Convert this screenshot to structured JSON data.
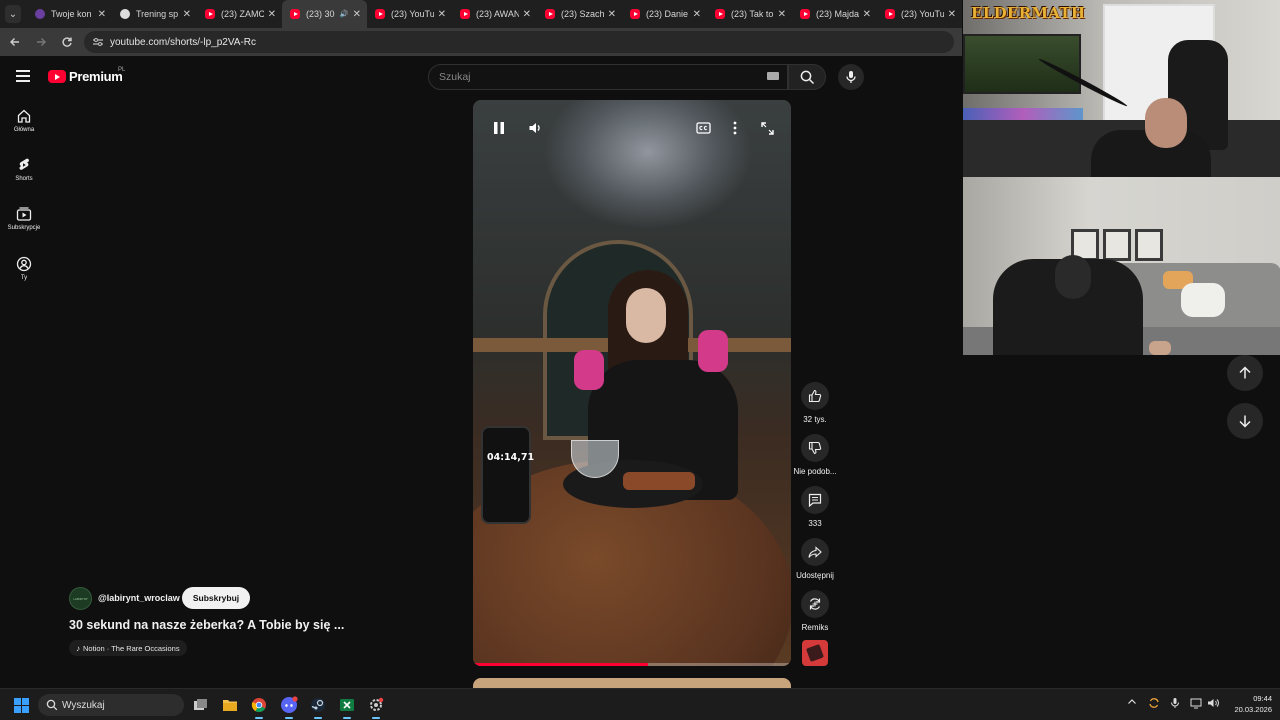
{
  "browser": {
    "tabs": [
      {
        "title": "Twoje kon",
        "favicon": "other-icon",
        "active": false
      },
      {
        "title": "Trening sp",
        "favicon": "soccer-ball-icon",
        "active": false
      },
      {
        "title": "(23) ZAMC",
        "favicon": "youtube-icon",
        "active": false
      },
      {
        "title": "(23) 30",
        "favicon": "youtube-icon",
        "active": true,
        "audio": true
      },
      {
        "title": "(23) YouTu",
        "favicon": "youtube-icon",
        "active": false
      },
      {
        "title": "(23) AWAN",
        "favicon": "youtube-icon",
        "active": false
      },
      {
        "title": "(23) Szach",
        "favicon": "youtube-icon",
        "active": false
      },
      {
        "title": "(23) Danie",
        "favicon": "youtube-icon",
        "active": false
      },
      {
        "title": "(23) Tak to",
        "favicon": "youtube-icon",
        "active": false
      },
      {
        "title": "(23) Majda",
        "favicon": "youtube-icon",
        "active": false
      },
      {
        "title": "(23) YouTu",
        "favicon": "youtube-icon",
        "active": false
      }
    ],
    "url": "youtube.com/shorts/-lp_p2VA-Rc"
  },
  "youtube": {
    "logo_text": "Premium",
    "region": "PL",
    "search_placeholder": "Szukaj",
    "sidebar": [
      {
        "label": "Główna",
        "icon": "home-icon"
      },
      {
        "label": "Shorts",
        "icon": "shorts-icon"
      },
      {
        "label": "Subskrypcje",
        "icon": "subscriptions-icon"
      },
      {
        "label": "Ty",
        "icon": "account-icon"
      }
    ],
    "overlay_timer": "04:14,71",
    "progress": 0.55,
    "actions": {
      "likes": "32 tys.",
      "dislike": "Nie podob...",
      "comments": "333",
      "share": "Udostępnij",
      "remix": "Remiks"
    },
    "channel": {
      "handle": "@labirynt_wroclaw",
      "avatar_text": "LABIRYNT",
      "subscribe_label": "Subskrybuj"
    },
    "video_title": "30 sekund na nasze żeberka? A Tobie by się ...",
    "music": "Notion · The Rare Occasions"
  },
  "stream_overlay": {
    "logo_text": "ELDERMATH"
  },
  "taskbar": {
    "search_text": "Wyszukaj",
    "time": "09:44",
    "date": "20.03.2026",
    "accent": "#3aa0ff"
  }
}
